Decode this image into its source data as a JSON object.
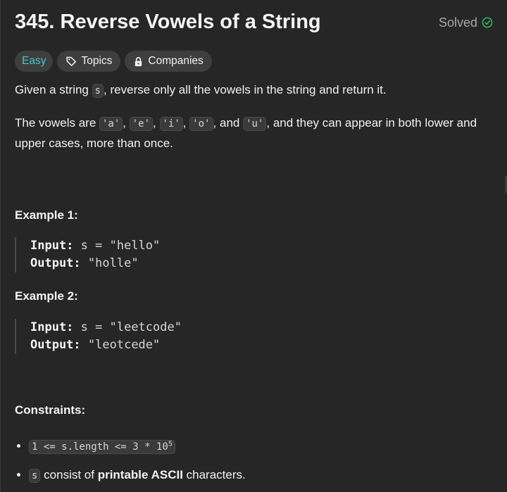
{
  "problem": {
    "title": "345. Reverse Vowels of a String",
    "solved_label": "Solved"
  },
  "tags": {
    "difficulty": "Easy",
    "topics": "Topics",
    "companies": "Companies"
  },
  "description": {
    "p1_pre": "Given a string ",
    "p1_code": "s",
    "p1_post": ", reverse only all the vowels in the string and return it.",
    "p2_pre": "The vowels are ",
    "vowels": [
      "'a'",
      "'e'",
      "'i'",
      "'o'",
      "'u'"
    ],
    "sep_comma": ", ",
    "sep_and": ", and ",
    "p2_post": ", and they can appear in both lower and upper cases, more than once."
  },
  "examples": [
    {
      "title": "Example 1:",
      "input_label": "Input:",
      "input_value": "s = \"hello\"",
      "output_label": "Output:",
      "output_value": "\"holle\""
    },
    {
      "title": "Example 2:",
      "input_label": "Input:",
      "input_value": "s = \"leetcode\"",
      "output_label": "Output:",
      "output_value": "\"leotcede\""
    }
  ],
  "constraints": {
    "title": "Constraints:",
    "c1_code": "1 <= s.length <= 3 * 10",
    "c1_sup": "5",
    "c2_code": "s",
    "c2_pre": " consist of ",
    "c2_bold": "printable ASCII",
    "c2_post": " characters."
  },
  "colors": {
    "background": "#262626",
    "easy": "#46c6c2",
    "solved_check": "#2cbb5d"
  }
}
